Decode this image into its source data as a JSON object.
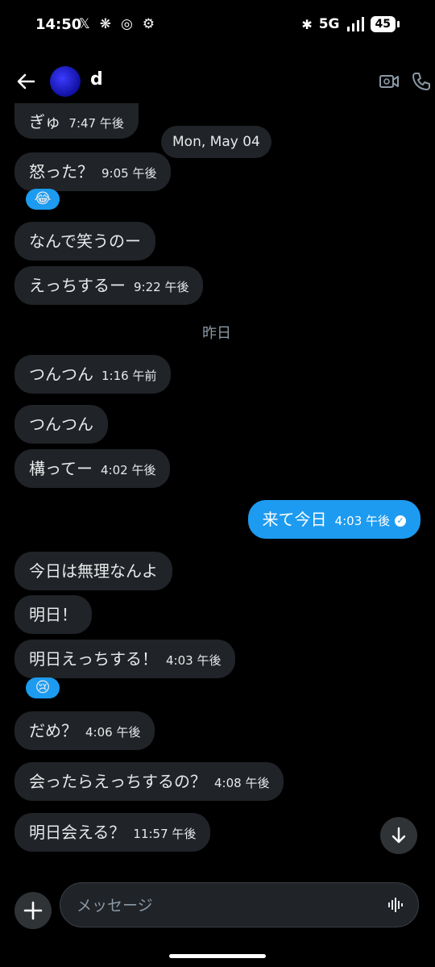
{
  "status_bar": {
    "time": "14:50",
    "network": "5G",
    "battery": "45"
  },
  "header": {
    "contact_name": "d"
  },
  "messages": [
    {
      "text": "ぎゅ",
      "time": "7:47 午後"
    },
    {
      "text": "怒った？",
      "time": "9:05 午後",
      "reaction": "😂"
    },
    {
      "text": "なんで笑うのー",
      "time": ""
    },
    {
      "text": "えっちするー",
      "time": "9:22 午後"
    },
    {
      "text": "つんつん",
      "time": "1:16 午前"
    },
    {
      "text": "つんつん",
      "time": ""
    },
    {
      "text": "構ってー",
      "time": "4:02 午後"
    },
    {
      "text": "来て今日",
      "time": "4:03 午後",
      "outgoing": true
    },
    {
      "text": "今日は無理なんよ",
      "time": ""
    },
    {
      "text": "明日！",
      "time": ""
    },
    {
      "text": "明日えっちする！",
      "time": "4:03 午後",
      "reaction": "😢"
    },
    {
      "text": "だめ？",
      "time": "4:06 午後"
    },
    {
      "text": "会ったらえっちするの？",
      "time": "4:08 午後"
    },
    {
      "text": "明日会える？",
      "time": "11:57 午後"
    }
  ],
  "date_chip": "Mon, May 04",
  "date_separator": "昨日",
  "composer": {
    "placeholder": "メッセージ"
  },
  "colors": {
    "background": "#000000",
    "incoming_bubble": "#202327",
    "outgoing_bubble": "#1d9bf0",
    "secondary_text": "#8b98a5"
  },
  "icons": [
    "back-arrow-icon",
    "video-call-icon",
    "phone-icon",
    "scroll-down-icon",
    "plus-icon",
    "voice-icon",
    "x-logo-icon",
    "settings-icon"
  ]
}
